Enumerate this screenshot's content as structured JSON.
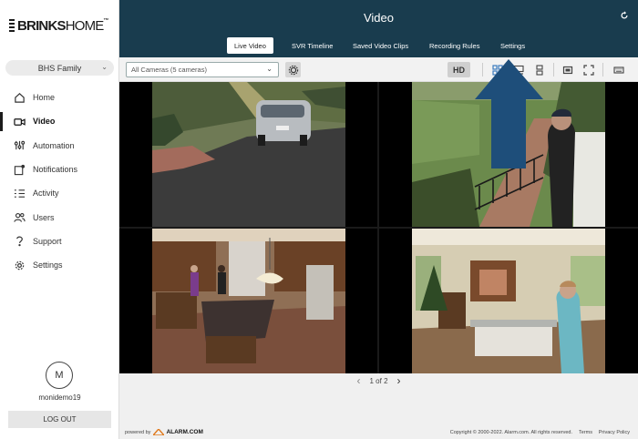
{
  "brand": {
    "name_bold": "BRINKS",
    "name_light": "HOME",
    "tm": "™"
  },
  "sidebar": {
    "system_name": "BHS Family",
    "items": [
      {
        "label": "Home",
        "icon": "home-icon"
      },
      {
        "label": "Video",
        "icon": "video-camera-icon",
        "active": true
      },
      {
        "label": "Automation",
        "icon": "sliders-icon"
      },
      {
        "label": "Notifications",
        "icon": "notification-icon"
      },
      {
        "label": "Activity",
        "icon": "activity-icon"
      },
      {
        "label": "Users",
        "icon": "users-icon"
      },
      {
        "label": "Support",
        "icon": "support-icon"
      },
      {
        "label": "Settings",
        "icon": "gear-icon"
      }
    ],
    "avatar_initial": "M",
    "username": "monidemo19",
    "logout_label": "LOG OUT"
  },
  "header": {
    "title": "Video",
    "tabs": [
      {
        "label": "Live Video",
        "active": true
      },
      {
        "label": "SVR Timeline"
      },
      {
        "label": "Saved Video Clips"
      },
      {
        "label": "Recording Rules"
      },
      {
        "label": "Settings"
      }
    ]
  },
  "toolbar": {
    "camera_select": "All Cameras (5 cameras)",
    "hd_label": "HD"
  },
  "pager": {
    "current": "1",
    "of_label": "of",
    "total": "2"
  },
  "footer": {
    "powered_by": "powered by",
    "alarm_brand": "ALARM.COM",
    "copyright": "Copyright © 2000-2022. Alarm.com. All rights reserved.",
    "terms": "Terms",
    "privacy": "Privacy Policy"
  },
  "colors": {
    "header_bg": "#193c4e",
    "arrow": "#1e4e7a"
  }
}
